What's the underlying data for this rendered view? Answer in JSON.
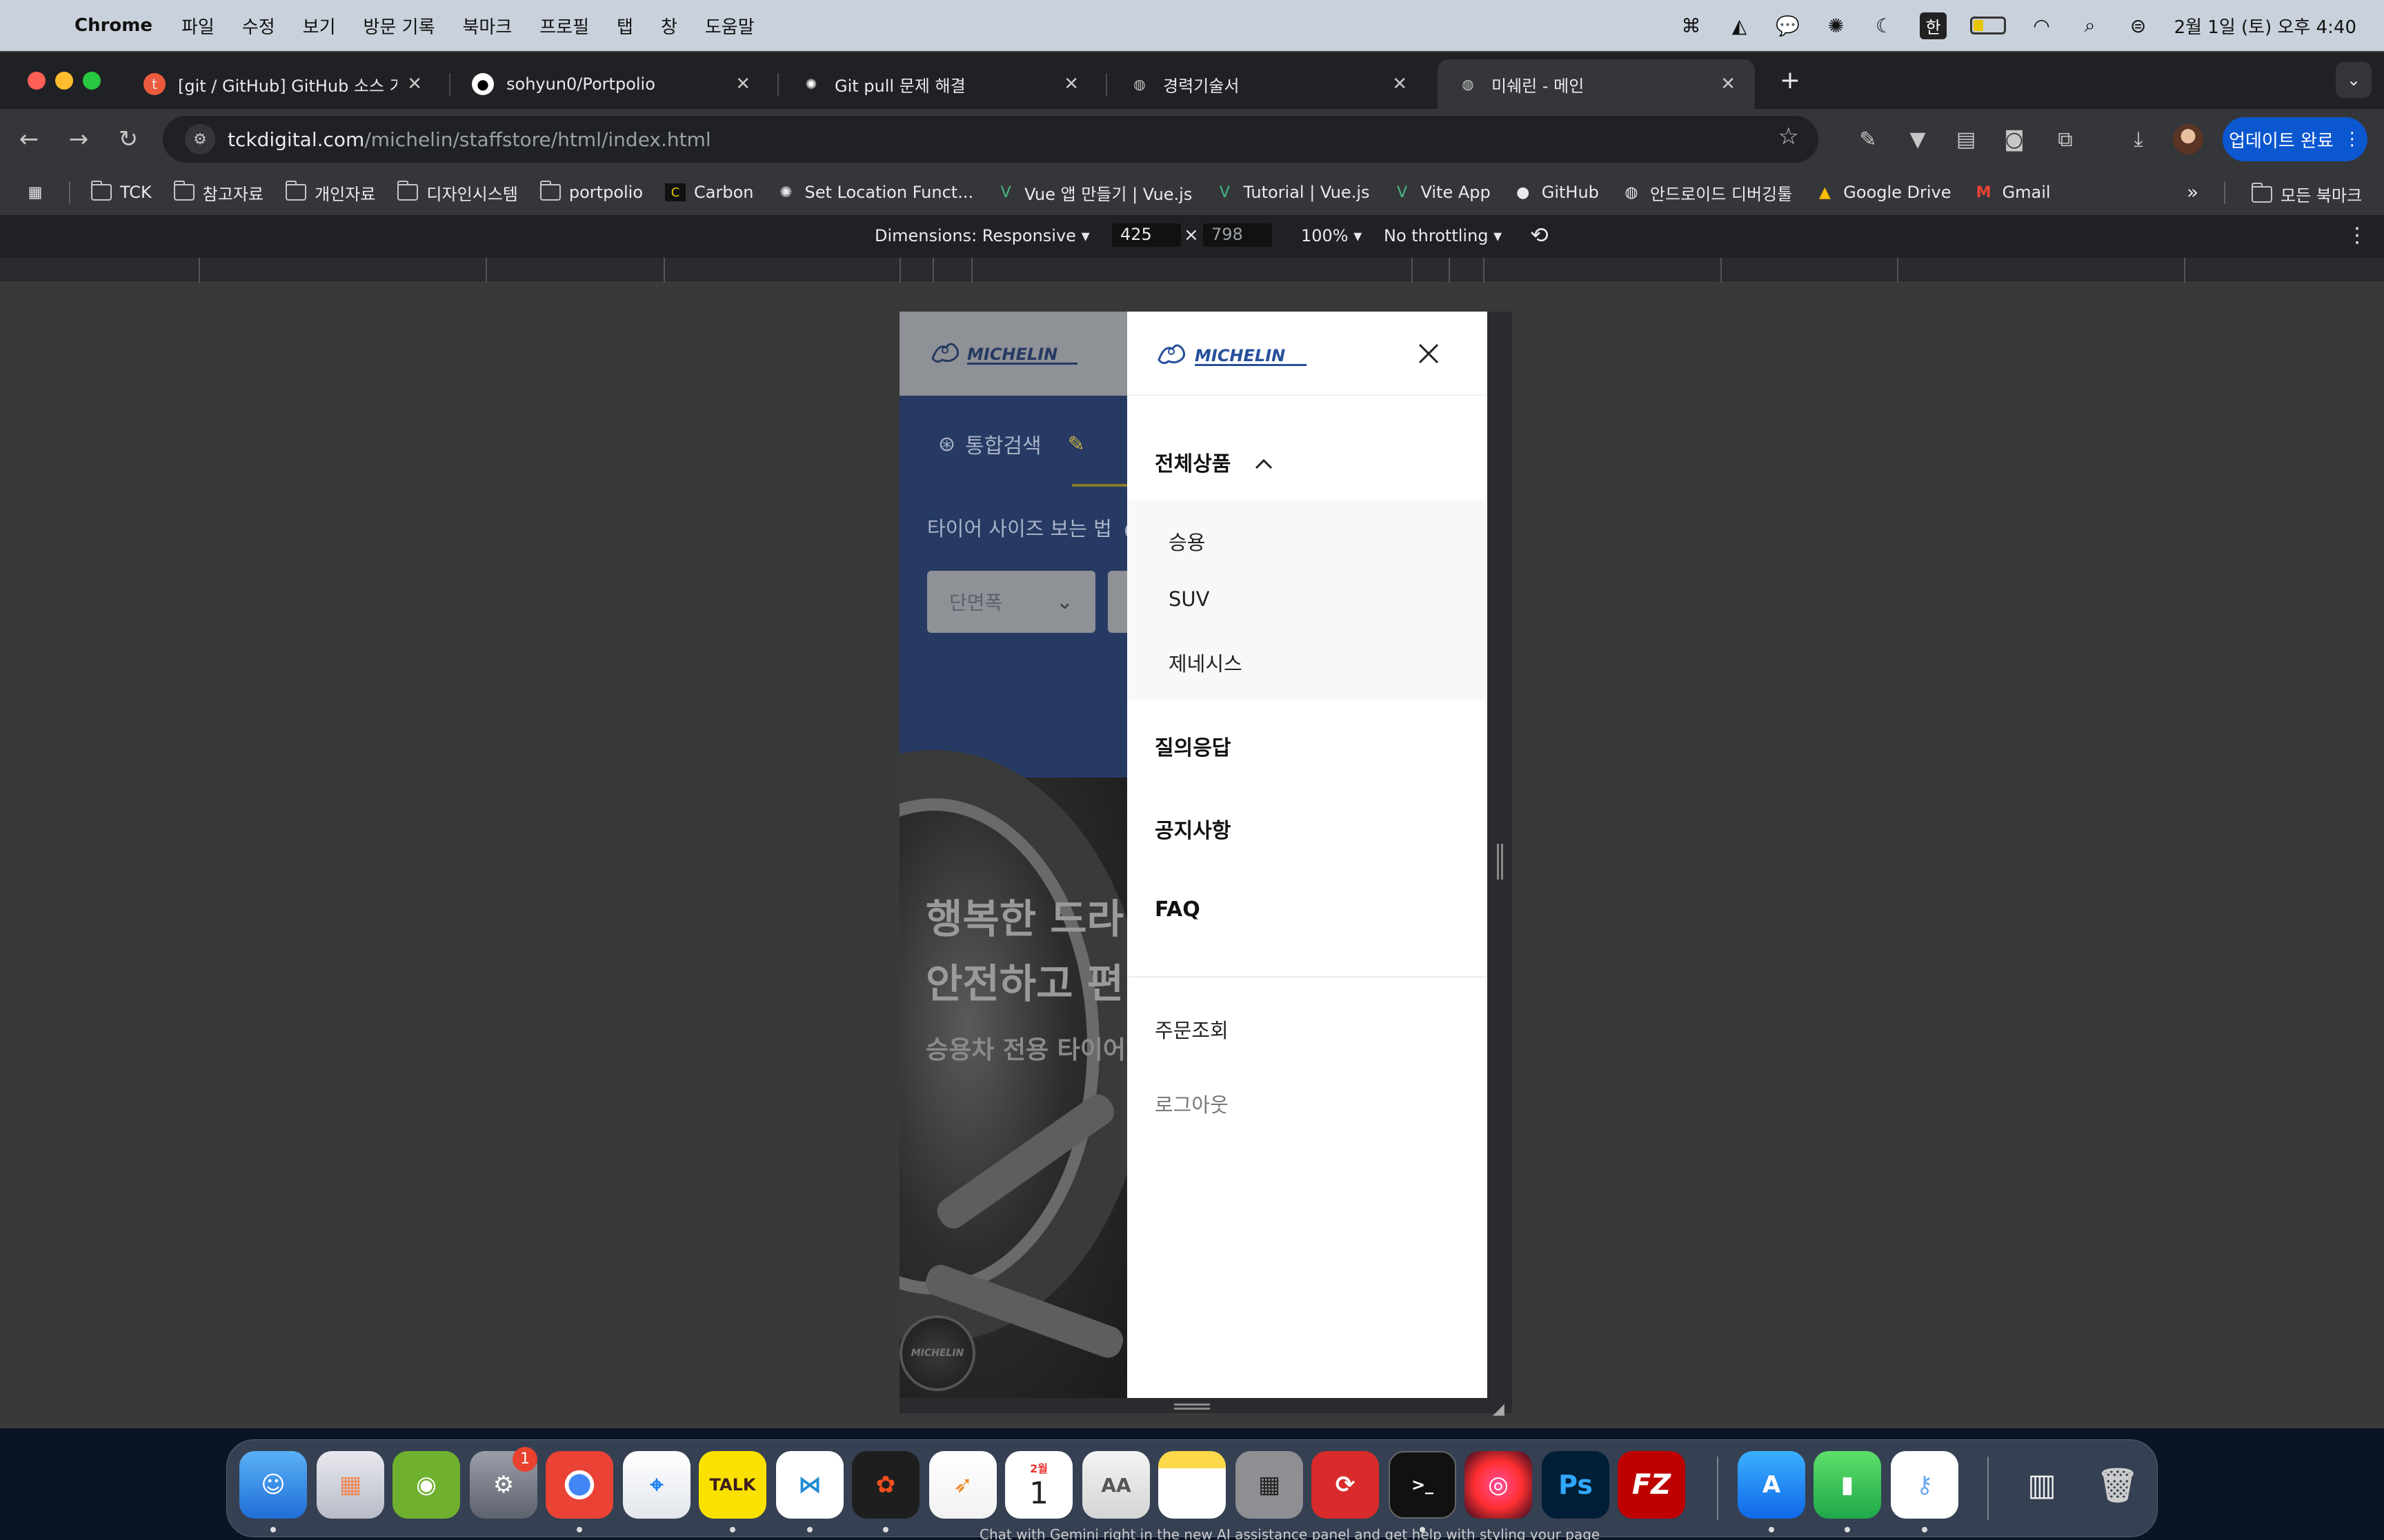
{
  "menubar": {
    "app": "Chrome",
    "items": [
      "파일",
      "수정",
      "보기",
      "방문 기록",
      "북마크",
      "프로필",
      "탭",
      "창",
      "도움말"
    ],
    "input_source": "한",
    "datetime": "2월 1일 (토) 오후 4:40"
  },
  "tabs": [
    {
      "title": "[git / GitHub] GitHub 소스 가져",
      "icon": "tistory-icon",
      "color": "#eb5a3c"
    },
    {
      "title": "sohyun0/Portpolio",
      "icon": "github-icon",
      "color": "#ffffff"
    },
    {
      "title": "Git pull 문제 해결",
      "icon": "openai-icon",
      "color": "#ffffff"
    },
    {
      "title": "경력기술서",
      "icon": "globe-icon",
      "color": "#ffffff"
    },
    {
      "title": "미쉐린 - 메인",
      "icon": "globe-icon",
      "color": "#ffffff"
    }
  ],
  "address": {
    "domain": "tckdigital.com",
    "path": "/michelin/staffstore/html/index.html"
  },
  "update_button": "업데이트 완료",
  "bookmarks": [
    {
      "label": "TCK",
      "type": "folder"
    },
    {
      "label": "참고자료",
      "type": "folder"
    },
    {
      "label": "개인자료",
      "type": "folder"
    },
    {
      "label": "디자인시스템",
      "type": "folder"
    },
    {
      "label": "portpolio",
      "type": "folder"
    },
    {
      "label": "Carbon",
      "type": "carbon"
    },
    {
      "label": "Set Location Funct...",
      "type": "openai"
    },
    {
      "label": "Vue 앱 만들기 | Vue.js",
      "type": "vue"
    },
    {
      "label": "Tutorial | Vue.js",
      "type": "vue"
    },
    {
      "label": "Vite App",
      "type": "vue"
    },
    {
      "label": "GitHub",
      "type": "github"
    },
    {
      "label": "안드로이드 디버깅툴",
      "type": "globe"
    },
    {
      "label": "Google Drive",
      "type": "drive"
    },
    {
      "label": "Gmail",
      "type": "gmail"
    }
  ],
  "all_bookmarks": "모든 북마크",
  "devtools": {
    "dimensions": "Dimensions: Responsive",
    "width": "425",
    "height": "798",
    "zoom": "100%",
    "throttling": "No throttling"
  },
  "site": {
    "brand": "MICHELIN",
    "nav_search": "통합검색",
    "tire_guide": "타이어 사이즈 보는 법",
    "select_placeholder": "단면폭",
    "hero_line1": "행복한 드라",
    "hero_line2": "안전하고 편",
    "hero_sub": "승용차 전용 타이어",
    "hub_text": "MICHELIN",
    "drawer": {
      "category_all": "전체상품",
      "sub_items": [
        "승용",
        "SUV",
        "제네시스"
      ],
      "qna": "질의응답",
      "notice": "공지사항",
      "faq": "FAQ",
      "order_lookup": "주문조회",
      "logout": "로그아웃"
    }
  },
  "dock": {
    "calendar_month": "2월",
    "calendar_day": "1",
    "settings_badge": "1",
    "kakaotalk": "TALK",
    "photoshop": "Ps",
    "filezilla": "FZ",
    "fontbook": "AA"
  },
  "gemini_hint": "Chat with Gemini right in the new AI assistance panel and get help with styling your page"
}
